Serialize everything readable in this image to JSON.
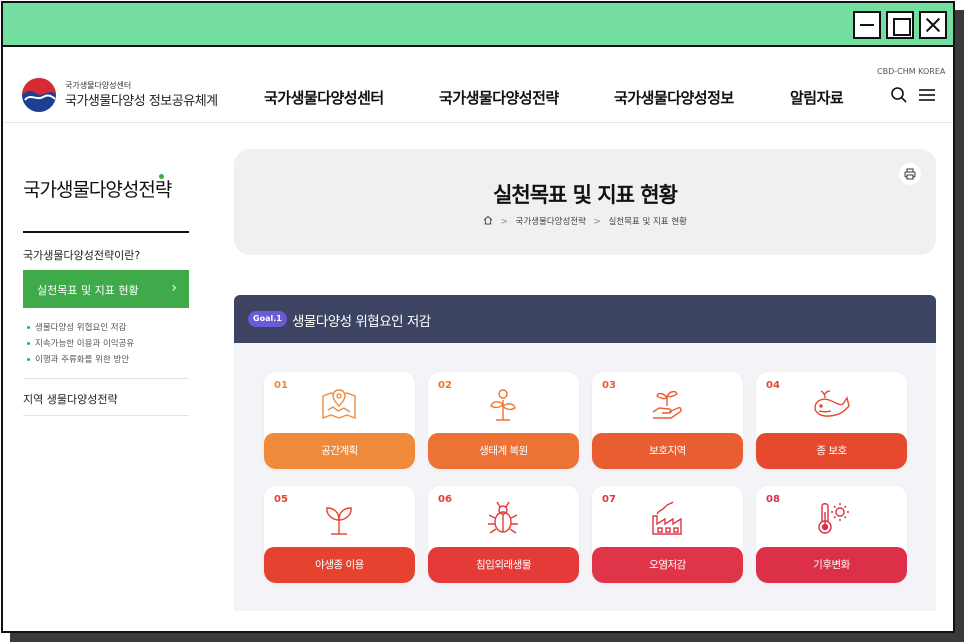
{
  "header": {
    "logo_small": "국가생물다양성센터",
    "logo_big": "국가생물다양성 정보공유체계",
    "top_right_label": "CBD-CHM KOREA",
    "nav": [
      "국가생물다양성센터",
      "국가생물다양성전략",
      "국가생물다양성정보",
      "알림자료"
    ]
  },
  "sidebar": {
    "title": "국가생물다양성전략",
    "items": [
      "국가생물다양성전략이란?",
      "실천목표 및 지표 현황",
      "지역 생물다양성전략"
    ],
    "active_chevron": "›",
    "sub_items": [
      "생물다양성 위협요인 저감",
      "지속가능한 이용과 이익공유",
      "이행과 주류화를 위한 방안"
    ]
  },
  "banner": {
    "title": "실천목표 및 지표 현황",
    "breadcrumbs": [
      "국가생물다양성전략",
      "실천목표 및 지표 현황"
    ],
    "separator": ">"
  },
  "goal": {
    "badge": "Goal.1",
    "title": "생물다양성 위협요인 저감",
    "cards": [
      {
        "num": "01",
        "label": "공간계획",
        "icon": "map-pin-icon",
        "color": "#ef8a3a"
      },
      {
        "num": "02",
        "label": "생태계 복원",
        "icon": "sprout-icon",
        "color": "#ec7335"
      },
      {
        "num": "03",
        "label": "보호지역",
        "icon": "hand-plant-icon",
        "color": "#e95e31"
      },
      {
        "num": "04",
        "label": "종 보호",
        "icon": "whale-icon",
        "color": "#e5492e"
      },
      {
        "num": "05",
        "label": "야생종 이용",
        "icon": "seedling-icon",
        "color": "#e5432f"
      },
      {
        "num": "06",
        "label": "침입외래생물",
        "icon": "bug-icon",
        "color": "#e43a38"
      },
      {
        "num": "07",
        "label": "오염저감",
        "icon": "factory-icon",
        "color": "#e03448"
      },
      {
        "num": "08",
        "label": "기후변화",
        "icon": "thermometer-sun-icon",
        "color": "#dc2f48"
      }
    ]
  },
  "colors": {
    "titlebar": "#73dea0",
    "sidebar_active": "#3faa49",
    "goal_header": "#3c4461",
    "goal_badge": "#6a5bd6"
  }
}
